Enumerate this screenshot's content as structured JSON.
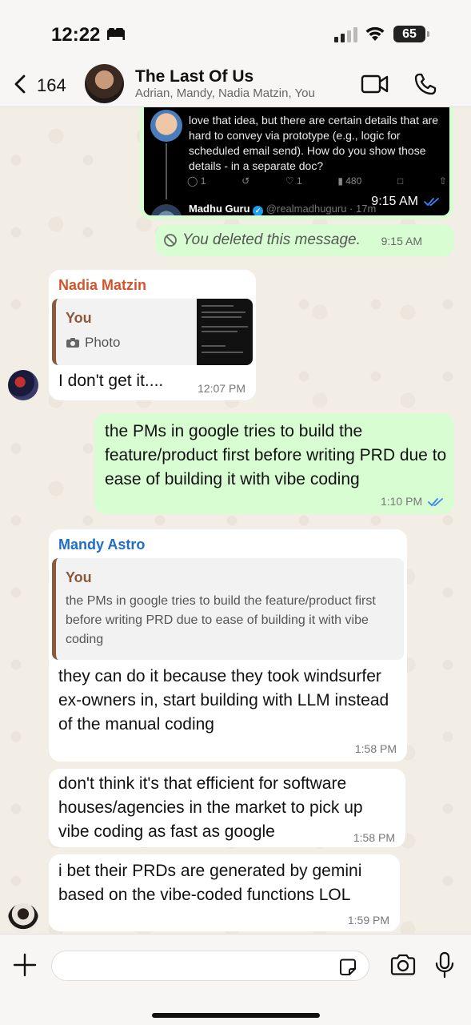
{
  "status_bar": {
    "time": "12:22",
    "battery": "65"
  },
  "header": {
    "back_count": "164",
    "title": "The Last Of Us",
    "subtitle": "Adrian, Mandy, Nadia Matzin, You"
  },
  "messages": {
    "tweet_embed": {
      "text": "love that idea, but there are certain details that are hard to convey via prototype (e.g., logic for scheduled email send). How do you show those details - in a separate doc?",
      "replies": "1",
      "likes": "1",
      "views": "480",
      "author": "Madhu Guru",
      "handle": "@realmadhuguru · 17m",
      "time": "9:15 AM"
    },
    "deleted": {
      "text": "You deleted this message.",
      "time": "9:15 AM"
    },
    "nadia": {
      "sender": "Nadia Matzin",
      "sender_color": "#d3542b",
      "quote_author": "You",
      "quote_type": "Photo",
      "text": "I don't get it....",
      "time": "12:07 PM"
    },
    "outgoing": {
      "text": "the PMs in google tries to build the feature/product first before writing PRD due to ease of building it with vibe coding",
      "time": "1:10 PM"
    },
    "mandy": {
      "sender": "Mandy Astro",
      "sender_color": "#1f6fc2",
      "quote_author": "You",
      "quote_text": "the PMs in google tries to build the feature/product first before writing PRD due to ease of building it with vibe coding",
      "text": "they can do it because they took windsurfer ex-owners in, start building with LLM instead of the manual coding",
      "time": "1:58 PM"
    },
    "mandy_2": {
      "text": "don't think it's that efficient for software houses/agencies in the market to pick up vibe coding as fast as google",
      "time": "1:58 PM"
    },
    "mandy_3": {
      "text": "i bet their PRDs are generated by gemini based on the vibe-coded functions LOL",
      "time": "1:59 PM"
    }
  },
  "colors": {
    "outgoing_bubble": "#d8fdd2",
    "incoming_bubble": "#ffffff",
    "read_ticks": "#3b82f6",
    "quote_accent": "#8a5a3c"
  }
}
